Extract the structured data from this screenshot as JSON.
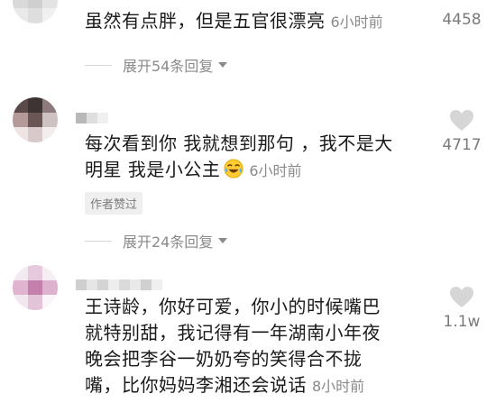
{
  "comments": [
    {
      "text": "虽然有点胖，但是五官很漂亮",
      "time": "6小时前",
      "likes": "4458",
      "replies_label": "展开54条回复"
    },
    {
      "text_line1": "每次看到你 我就想到那句 ，我不是大",
      "text_line2": "明星 我是小公主",
      "emoji": "tears-of-joy-emoji",
      "time": "6小时前",
      "likes": "4717",
      "badge": "作者赞过",
      "replies_label": "展开24条回复"
    },
    {
      "text_line1": "王诗龄，你好可爱，你小的时候嘴巴",
      "text_line2": "就特别甜，我记得有一年湖南小年夜",
      "text_line3": "晚会把李谷一奶奶夸的笑得合不拢",
      "text_line4": "嘴，比你妈妈李湘还会说话",
      "time": "8小时前",
      "likes": "1.1w"
    }
  ],
  "icons": {
    "like": "heart-icon",
    "expand": "chevron-down-icon"
  },
  "colors": {
    "text": "#1a1a1a",
    "meta": "#8a8a8a",
    "heart": "#d6d6d6",
    "badge_bg": "#efefef"
  }
}
